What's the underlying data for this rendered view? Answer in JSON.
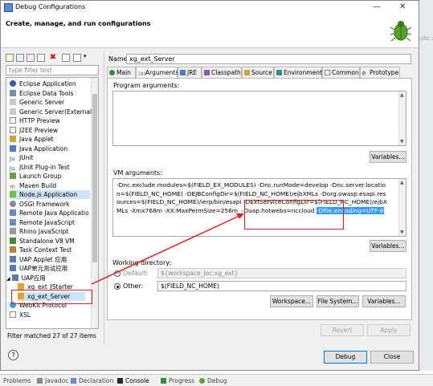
{
  "window": {
    "title": "Debug Configurations",
    "minimize": "—",
    "close": "✕"
  },
  "header": {
    "title": "Create, manage, and run configurations"
  },
  "colors": {
    "highlight": "#cce4f7",
    "selection": "#3399ff",
    "annotation": "#e02020"
  },
  "left": {
    "filter_placeholder": "type filter text",
    "toolbar_icons": [
      "new-config-icon",
      "duplicate-icon",
      "export-icon",
      "delete-icon",
      "collapse-all-icon",
      "filter-icon"
    ],
    "items": [
      {
        "label": "Eclipse Application",
        "icon": "eclipse-icon"
      },
      {
        "label": "Eclipse Data Tools",
        "icon": "database-icon"
      },
      {
        "label": "Generic Server",
        "icon": "server-icon"
      },
      {
        "label": "Generic Server(External",
        "icon": "server-icon"
      },
      {
        "label": "HTTP Preview",
        "icon": "http-icon"
      },
      {
        "label": "J2EE Preview",
        "icon": "j2ee-icon"
      },
      {
        "label": "Java Applet",
        "icon": "applet-icon"
      },
      {
        "label": "Java Application",
        "icon": "java-icon"
      },
      {
        "label": "JUnit",
        "icon": "junit-icon"
      },
      {
        "label": "JUnit Plug-in Test",
        "icon": "junit-icon"
      },
      {
        "label": "Launch Group",
        "icon": "launch-icon"
      },
      {
        "label": "Maven Build",
        "icon": "maven-icon"
      },
      {
        "label": "Node.js Application",
        "icon": "nodejs-icon"
      },
      {
        "label": "OSGi Framework",
        "icon": "osgi-icon"
      },
      {
        "label": "Remote Java Applicatio",
        "icon": "remote-icon"
      },
      {
        "label": "Remote JavaScript",
        "icon": "remote-icon"
      },
      {
        "label": "Rhino JavaScript",
        "icon": "rhino-icon"
      },
      {
        "label": "Standalone V8 VM",
        "icon": "v8-icon"
      },
      {
        "label": "Task Context Test",
        "icon": "task-icon"
      },
      {
        "label": "UAP Applet 应用",
        "icon": "uap-icon"
      },
      {
        "label": "UAP单元测试应用",
        "icon": "uap-icon"
      },
      {
        "label": "UAP应用",
        "icon": "uap-icon"
      },
      {
        "label": "xg_ext_JStarter",
        "icon": "uap-icon"
      },
      {
        "label": "xg_ext_Server",
        "icon": "uap-icon"
      },
      {
        "label": "WebKit Protocol",
        "icon": "webkit-icon"
      },
      {
        "label": "XSL",
        "icon": "xsl-icon"
      }
    ],
    "footer": "Filter matched 27 of 27 items"
  },
  "right": {
    "name_label": "Name:",
    "name_value": "xg_ext_Server",
    "tabs": [
      "Main",
      "Arguments",
      "JRE",
      "Classpath",
      "Source",
      "Environment",
      "Common",
      "Prototype"
    ],
    "program_args_label": "Program arguments:",
    "vm_args_label": "VM arguments:",
    "vm_args_before": "-Dnc.exclude.modules=$(FIELD_EX_MODULES) -Dnc.runMode=develop -Dnc.server.location=$(FIELD_NC_HOME) -DEJBConfigDir=$(FIELD_NC_HOME)/ejbXMLs -Dorg.owasp.esapi.resources=$(FIELD_NC_HOME)/ierp/bin/esapi -DExtServiceConfigDir=$(FIELD_NC_HOME)/ejbXMLs -Xmx768m -XX:MaxPermSize=256m  -Duap.hotwebs=nccloud ",
    "vm_args_selected": "-Dfile.encoding=UTF-8",
    "variables_btn": "Variables...",
    "working_dir_label": "Working directory:",
    "default_label": "Default:",
    "default_value": "${workspace_loc:xg_ext}",
    "other_label": "Other:",
    "other_value": "$(FIELD_NC_HOME)",
    "workspace_btn": "Workspace...",
    "filesystem_btn": "File System...",
    "variables2_btn": "Variables...",
    "revert_btn": "Revert",
    "apply_btn": "Apply"
  },
  "dialog": {
    "debug_btn": "Debug",
    "close_btn": "Close",
    "help": "?"
  },
  "bottom_tabs": [
    "Problems",
    "Javadoc",
    "Declaration",
    "Console",
    "Progress",
    "Debug"
  ],
  "right_strip": {
    "text": "ulic.as"
  }
}
